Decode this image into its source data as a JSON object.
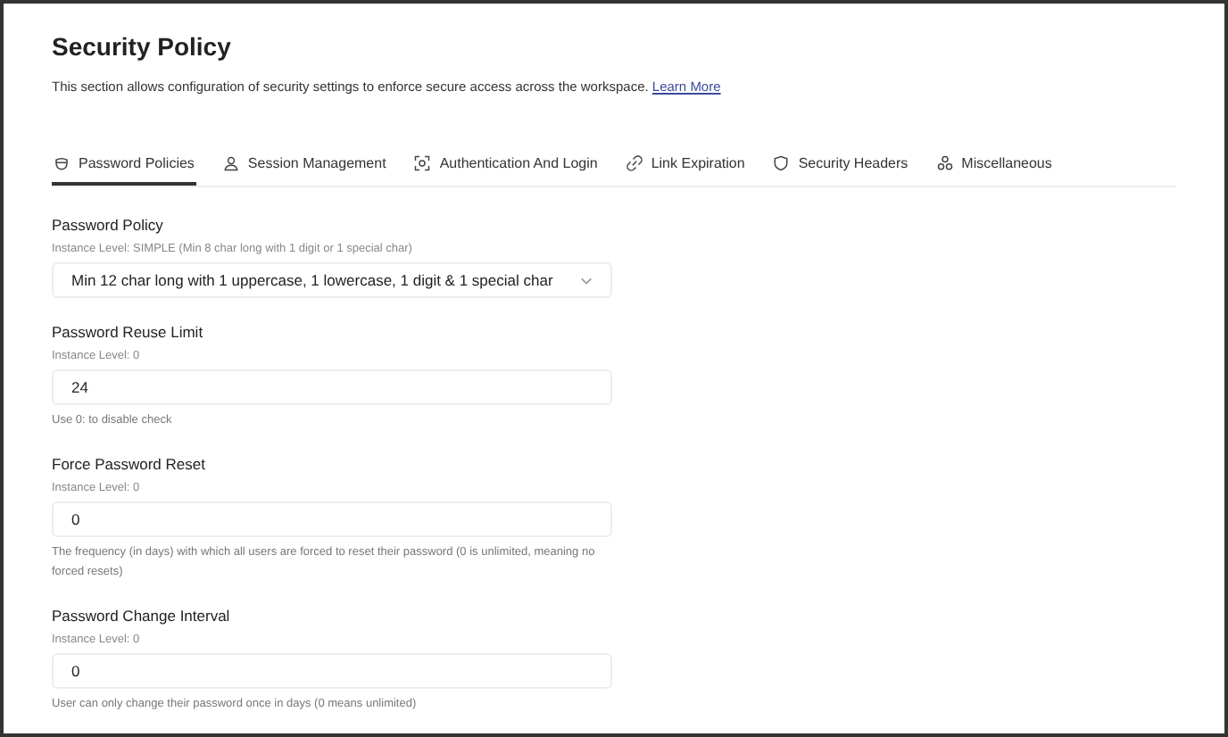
{
  "page": {
    "title": "Security Policy",
    "description": "This section allows configuration of security settings to enforce secure access across the workspace.",
    "link": "Learn More"
  },
  "tabs": [
    {
      "label": "Password Policies",
      "kind": "mask",
      "selected": true
    },
    {
      "label": "Session Management",
      "kind": "user",
      "selected": false
    },
    {
      "label": "Authentication And Login",
      "kind": "scan",
      "selected": false
    },
    {
      "label": "Link Expiration",
      "kind": "link",
      "selected": false
    },
    {
      "label": "Security Headers",
      "kind": "shield",
      "selected": false
    },
    {
      "label": "Miscellaneous",
      "kind": "circles",
      "selected": false
    }
  ],
  "fields": [
    {
      "kind": "select",
      "label": "Password Policy",
      "instance": "Instance Level: SIMPLE (Min 8 char long with 1 digit or 1 special char)",
      "value": "Min 12 char long with 1 uppercase, 1 lowercase, 1 digit & 1 special char"
    },
    {
      "kind": "input",
      "label": "Password Reuse Limit",
      "instance": "Instance Level: 0",
      "value": "24",
      "hint": "Use 0: to disable check"
    },
    {
      "kind": "input",
      "label": "Force Password Reset",
      "instance": "Instance Level: 0",
      "value": "0",
      "hint": "The frequency (in days) with which all users are forced to reset their password (0 is unlimited, meaning no forced resets)"
    },
    {
      "kind": "input",
      "label": "Password Change Interval",
      "instance": "Instance Level: 0",
      "value": "0",
      "hint": "User can only change their password once in days (0 means unlimited)"
    }
  ]
}
